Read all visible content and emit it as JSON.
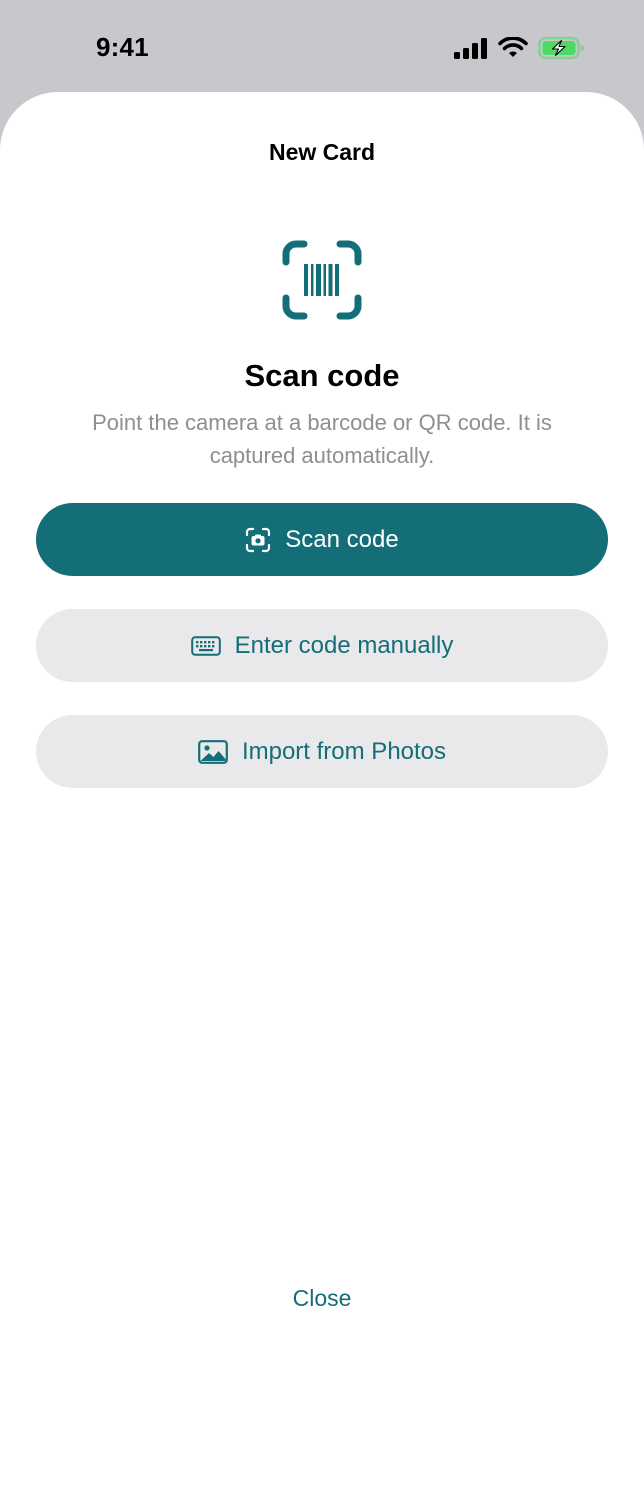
{
  "status_bar": {
    "time": "9:41",
    "icons": [
      "cellular-signal-icon",
      "wifi-icon",
      "battery-charging-icon"
    ]
  },
  "sheet": {
    "title": "New Card",
    "hero_icon": "barcode-scan-icon",
    "heading": "Scan code",
    "description": "Point the camera at a barcode or QR code. It is captured automatically."
  },
  "actions": {
    "scan": {
      "label": "Scan code",
      "icon": "camera-scan-icon"
    },
    "manual": {
      "label": "Enter code manually",
      "icon": "keyboard-icon"
    },
    "photos": {
      "label": "Import from Photos",
      "icon": "photo-icon"
    }
  },
  "footer": {
    "close_label": "Close"
  },
  "colors": {
    "accent": "#136e78",
    "secondary_bg": "#e9e9eb",
    "muted_text": "#8e8e93",
    "backdrop": "#c7c7cc",
    "battery_green": "#4cd964"
  }
}
